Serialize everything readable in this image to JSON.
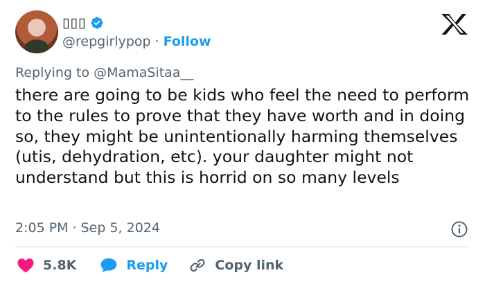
{
  "author": {
    "display_name": "▯▯▯",
    "handle": "@repgirlypop",
    "separator": "·",
    "follow_label": "Follow"
  },
  "reply_context": {
    "prefix": "Replying to",
    "mention": "@MamaSitaa__"
  },
  "tweet": {
    "text": "there are going to be kids who feel the need to perform to the rules to prove that they have worth and in doing so, they might be unintentionally harming themselves (utis, dehydration, etc). your daughter might not understand but this is horrid on so many levels",
    "time": "2:05 PM",
    "separator": "·",
    "date": "Sep 5, 2024"
  },
  "actions": {
    "like_count": "5.8K",
    "reply_label": "Reply",
    "copy_link_label": "Copy link"
  },
  "colors": {
    "accent": "#1d9bf0",
    "like": "#f91880",
    "secondary_text": "#536471"
  },
  "icons": [
    "verified-badge-icon",
    "x-logo-icon",
    "info-icon",
    "heart-icon",
    "speech-bubble-icon",
    "link-icon"
  ]
}
